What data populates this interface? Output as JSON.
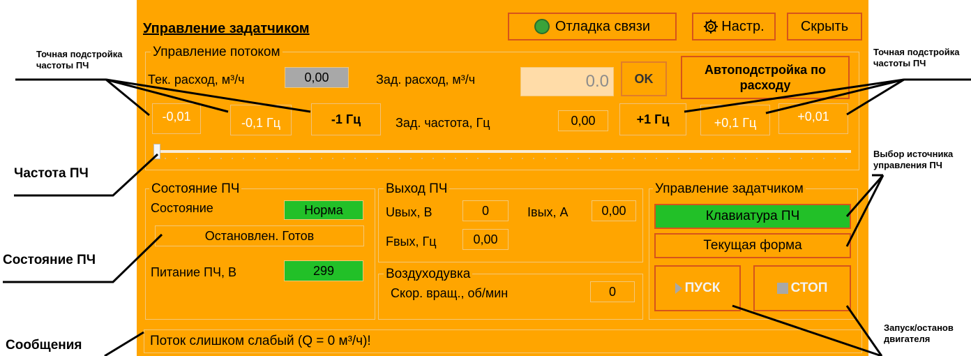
{
  "panel": {
    "title": "Управление задатчиком",
    "debug_button": "Отладка связи",
    "settings_button": "Настр.",
    "hide_button": "Скрыть"
  },
  "flow": {
    "group_title": "Управление потоком",
    "current_flow_label": "Тек. расход, м³/ч",
    "current_flow_value": "0,00",
    "set_flow_label": "Зад. расход, м³/ч",
    "set_flow_value": "0.0",
    "ok_button": "OK",
    "auto_tune_button": "Автоподстройка по расходу",
    "minus_001": "-0,01",
    "minus_01": "-0,1 Гц",
    "minus_1": "-1 Гц",
    "set_freq_label": "Зад. частота, Гц",
    "set_freq_value": "0,00",
    "plus_1": "+1 Гц",
    "plus_01": "+0,1 Гц",
    "plus_001": "+0,01"
  },
  "vfd_state": {
    "group_title": "Состояние ПЧ",
    "state_label": "Состояние",
    "state_value": "Норма",
    "status_text": "Остановлен. Готов",
    "power_label": "Питание ПЧ, В",
    "power_value": "299"
  },
  "vfd_output": {
    "group_title": "Выход ПЧ",
    "u_label": "Uвых, В",
    "u_value": "0",
    "i_label": "Iвых, А",
    "i_value": "0,00",
    "f_label": "Fвых, Гц",
    "f_value": "0,00"
  },
  "blower": {
    "group_title": "Воздуходувка",
    "speed_label": "Скор. вращ., об/мин",
    "speed_value": "0"
  },
  "control": {
    "group_title": "Управление задатчиком",
    "keyboard_button": "Клавиатура ПЧ",
    "current_form_button": "Текущая форма",
    "start_button": "ПУСК",
    "stop_button": "СТОП"
  },
  "messages": {
    "text": "Поток слишком слабый (Q = 0 м³/ч)!"
  },
  "annotations": {
    "fine_tune_left": [
      "Точная подстройка",
      "частоты ПЧ"
    ],
    "fine_tune_right": [
      "Точная подстройка",
      "частоты ПЧ"
    ],
    "freq": "Частота ПЧ",
    "state": "Состояние ПЧ",
    "messages": "Сообщения",
    "source": [
      "Выбор источника",
      "управления ПЧ"
    ],
    "start_stop": [
      "Запуск/останов",
      "двигателя"
    ]
  },
  "colors": {
    "panel_bg": "#ffa500",
    "button_border": "#d6541b",
    "ok_green": "#22c028",
    "readout_gray": "#a8a8a8"
  },
  "slider": {
    "value_fraction": 0
  }
}
